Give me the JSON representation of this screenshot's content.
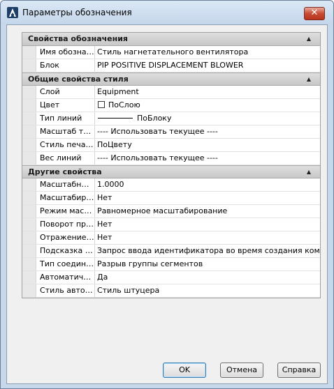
{
  "window": {
    "title": "Параметры обозначения",
    "close_label": "✕"
  },
  "sections": [
    {
      "title": "Свойства обозначения",
      "rows": [
        {
          "name": "Имя обознач...",
          "value": "Стиль нагнетательного вентилятора"
        },
        {
          "name": "Блок",
          "value": "PIP POSITIVE DISPLACEMENT BLOWER"
        }
      ]
    },
    {
      "title": "Общие свойства стиля",
      "rows": [
        {
          "name": "Слой",
          "value": "Equipment"
        },
        {
          "name": "Цвет",
          "value": "ПоСлою"
        },
        {
          "name": "Тип линий",
          "value": "ПоБлоку"
        },
        {
          "name": "Масштаб ти...",
          "value": "---- Использовать текущее ----"
        },
        {
          "name": "Стиль печати",
          "value": "ПоЦвету"
        },
        {
          "name": "Вес линий",
          "value": "---- Использовать текущее ----"
        }
      ]
    },
    {
      "title": "Другие свойства",
      "rows": [
        {
          "name": "Масштабны...",
          "value": "1.0000"
        },
        {
          "name": "Масштабиро...",
          "value": "Нет"
        },
        {
          "name": "Режим масш...",
          "value": "Равномерное масштабирование"
        },
        {
          "name": "Поворот при...",
          "value": "Нет"
        },
        {
          "name": "Отражение п...",
          "value": "Нет"
        },
        {
          "name": "Подсказка ид...",
          "value": "Запрос ввода идентификатора во время создания ком..."
        },
        {
          "name": "Тип соедине...",
          "value": "Разрыв группы сегментов"
        },
        {
          "name": "Автоматичес...",
          "value": "Да"
        },
        {
          "name": "Стиль автом...",
          "value": "Стиль штуцера"
        }
      ]
    }
  ],
  "buttons": {
    "ok": "OK",
    "cancel": "Отмена",
    "help": "Справка"
  },
  "colors": {
    "titlebar": "#c4d6ea",
    "close": "#c84a33",
    "section_header": "#d4d4d4"
  },
  "icons": {
    "app": "autocad-plant-icon",
    "collapse": "collapse-triangle-icon"
  }
}
